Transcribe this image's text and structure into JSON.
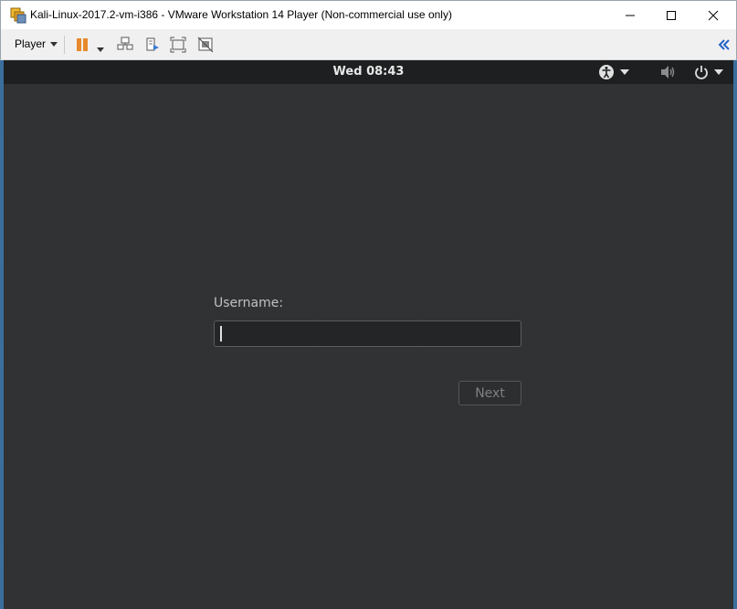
{
  "window": {
    "title": "Kali-Linux-2017.2-vm-i386 - VMware Workstation 14 Player (Non-commercial use only)"
  },
  "toolbar": {
    "player_label": "Player",
    "icons": [
      "pause-icon",
      "chevron-down-icon",
      "send-ctrl-alt-del-icon",
      "removable-devices-icon",
      "full-screen-icon",
      "unity-icon",
      "collapse-toolbar-icon"
    ],
    "accent": "#e8892b"
  },
  "guest": {
    "clock": "Wed 08:43",
    "tray_icons": [
      "accessibility-icon",
      "volume-icon",
      "power-icon"
    ],
    "login": {
      "username_label": "Username:",
      "username_value": "",
      "next_label": "Next"
    }
  }
}
